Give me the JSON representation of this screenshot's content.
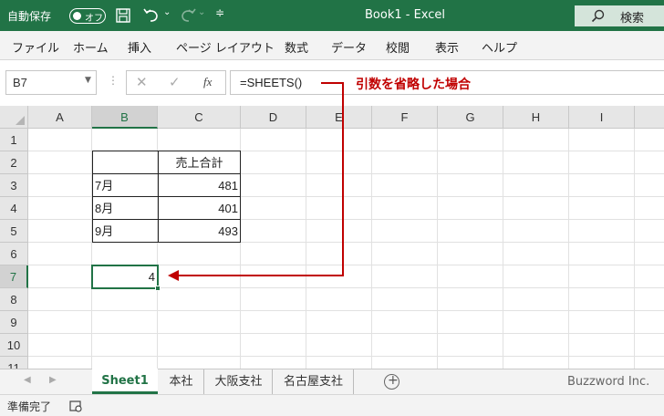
{
  "titlebar": {
    "autosave_label": "自動保存",
    "autosave_state": "オフ",
    "title": "Book1 - Excel",
    "search_label": "検索"
  },
  "menu": [
    "ファイル",
    "ホーム",
    "挿入",
    "ページ レイアウト",
    "数式",
    "データ",
    "校閲",
    "表示",
    "ヘルプ"
  ],
  "formula_bar": {
    "name_box": "B7",
    "formula": "=SHEETS()",
    "fx_label": "fx"
  },
  "annotation": "引数を省略した場合",
  "columns": [
    "A",
    "B",
    "C",
    "D",
    "E",
    "F",
    "G",
    "H",
    "I"
  ],
  "rows": [
    "1",
    "2",
    "3",
    "4",
    "5",
    "6",
    "7",
    "8",
    "9",
    "10",
    "11"
  ],
  "cells": {
    "c2": "売上合計",
    "b3": "7月",
    "c3": "481",
    "b4": "8月",
    "c4": "401",
    "b5": "9月",
    "c5": "493",
    "b7": "4"
  },
  "sheet_tabs": [
    "Sheet1",
    "本社",
    "大阪支社",
    "名古屋支社"
  ],
  "status_text": "準備完了",
  "watermark": "Buzzword Inc.",
  "colors": {
    "excel_green": "#217346",
    "arrow_red": "#c00000"
  }
}
